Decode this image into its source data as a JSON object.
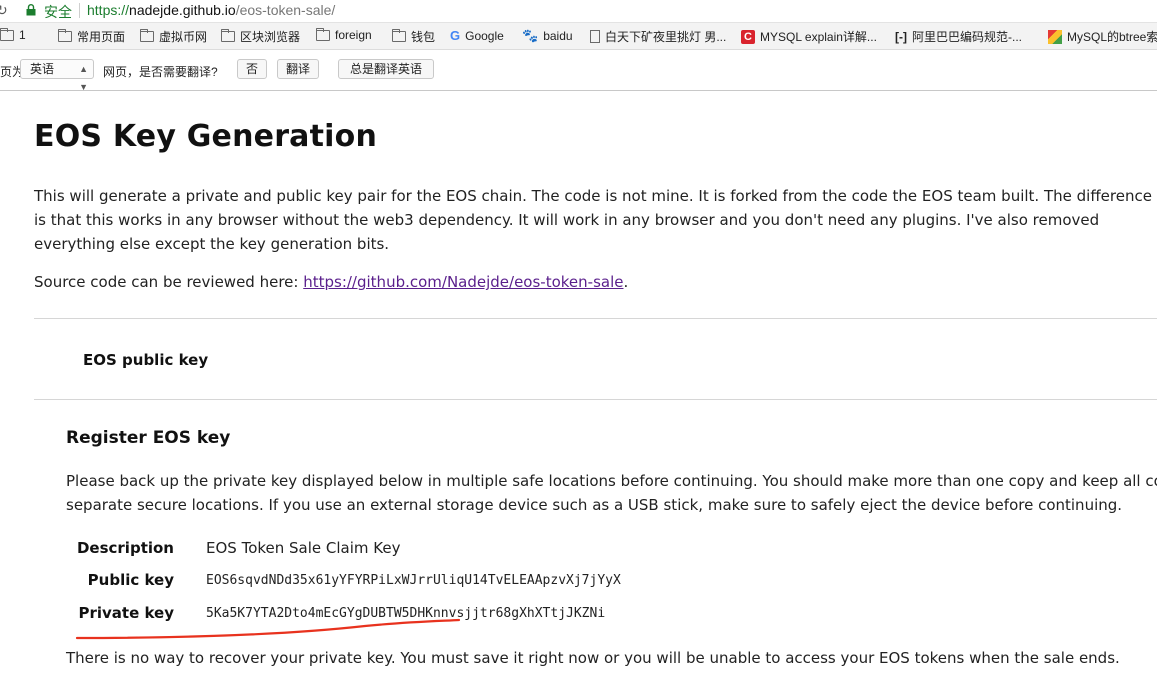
{
  "browser": {
    "secure_label": "安全",
    "url": {
      "scheme": "https://",
      "host": "nadejde.github.io",
      "path": "/eos-token-sale/"
    },
    "bookmarks": [
      {
        "label": "1",
        "icon": "folder-icon"
      },
      {
        "label": "常用页面",
        "icon": "folder-icon"
      },
      {
        "label": "虚拟币网",
        "icon": "folder-icon"
      },
      {
        "label": "区块浏览器",
        "icon": "folder-icon"
      },
      {
        "label": "foreign",
        "icon": "folder-icon"
      },
      {
        "label": "钱包",
        "icon": "folder-icon"
      },
      {
        "label": "Google",
        "icon": "google-icon"
      },
      {
        "label": "baidu",
        "icon": "paw-icon"
      },
      {
        "label": "白天下矿夜里挑灯 男...",
        "icon": "page-icon"
      },
      {
        "label": "MYSQL explain详解...",
        "icon": "c-icon"
      },
      {
        "label": "阿里巴巴编码规范-...",
        "icon": "bracket-icon"
      },
      {
        "label": "MySQL的btree索",
        "icon": "color-icon"
      }
    ],
    "translate_bar": {
      "prefix": "页为",
      "language": "英语",
      "question": "网页，是否需要翻译?",
      "no_button": "否",
      "translate_button": "翻译",
      "always_button": "总是翻译英语"
    }
  },
  "page": {
    "title": "EOS Key Generation",
    "intro": "This will generate a private and public key pair for the EOS chain. The code is not mine. It is forked from the code the EOS team built. The difference is that this works in any browser without the web3 dependency. It will work in any browser and you don't need any plugins. I've also removed everything else except the key generation bits.",
    "source_prefix": "Source code can be reviewed here: ",
    "source_link": "https://github.com/Nadejde/eos-token-sale",
    "source_suffix": ".",
    "public_key_heading": "EOS public key",
    "register_heading": "Register EOS key",
    "warning_line1": "Please back up the private key displayed below in multiple safe locations before continuing. You should make more than one copy and keep all cop",
    "warning_line2": "separate secure locations. If you use an external storage device such as a USB stick, make sure to safely eject the device before continuing.",
    "rows": {
      "description_label": "Description",
      "description_value": "EOS Token Sale Claim Key",
      "public_label": "Public key",
      "public_value": "EOS6sqvdNDd35x61yYFYRPiLxWJrrUliqU14TvELEAApzvXj7jYyX",
      "private_label": "Private key",
      "private_value": "5Ka5K7YTA2Dto4mEcGYgDUBTW5DHKnnvsjjtr68gXhXTtjJKZNi"
    },
    "final_note": "There is no way to recover your private key. You must save it right now or you will be unable to access your EOS tokens when the sale ends."
  },
  "colors": {
    "secure_green": "#1b7d2e",
    "link_purple": "#5a1f8c",
    "annotation_red": "#e8321e"
  }
}
